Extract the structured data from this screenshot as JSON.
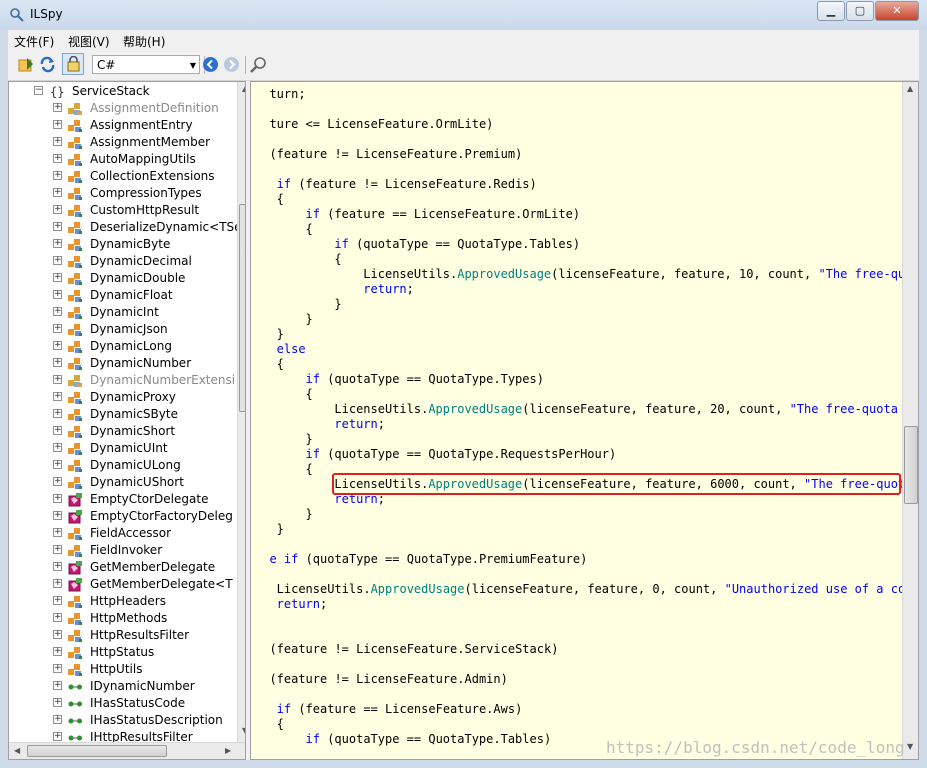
{
  "window": {
    "title": "ILSpy",
    "minimize": "▁",
    "maximize": "▢",
    "close": "✕"
  },
  "menu": [
    "文件(F)",
    "视图(V)",
    "帮助(H)"
  ],
  "toolbar": {
    "language": "C#",
    "icons": [
      "open-icon",
      "reload-icon",
      "show-internal-icon",
      "back-icon",
      "forward-icon",
      "search-icon"
    ]
  },
  "tree": {
    "namespace": {
      "label": "ServiceStack",
      "icon": "namespace-icon"
    },
    "items": [
      {
        "label": "AssignmentDefinition",
        "icon": "internal-class-icon",
        "gray": true
      },
      {
        "label": "AssignmentEntry",
        "icon": "class-icon",
        "gray": false
      },
      {
        "label": "AssignmentMember",
        "icon": "class-icon",
        "gray": false
      },
      {
        "label": "AutoMappingUtils",
        "icon": "class-icon",
        "gray": false
      },
      {
        "label": "CollectionExtensions",
        "icon": "class-icon",
        "gray": false
      },
      {
        "label": "CompressionTypes",
        "icon": "class-icon",
        "gray": false
      },
      {
        "label": "CustomHttpResult",
        "icon": "class-icon",
        "gray": false
      },
      {
        "label": "DeserializeDynamic<TSe",
        "icon": "class-icon",
        "gray": false
      },
      {
        "label": "DynamicByte",
        "icon": "class-icon",
        "gray": false
      },
      {
        "label": "DynamicDecimal",
        "icon": "class-icon",
        "gray": false
      },
      {
        "label": "DynamicDouble",
        "icon": "class-icon",
        "gray": false
      },
      {
        "label": "DynamicFloat",
        "icon": "class-icon",
        "gray": false
      },
      {
        "label": "DynamicInt",
        "icon": "class-icon",
        "gray": false
      },
      {
        "label": "DynamicJson",
        "icon": "class-icon",
        "gray": false
      },
      {
        "label": "DynamicLong",
        "icon": "class-icon",
        "gray": false
      },
      {
        "label": "DynamicNumber",
        "icon": "class-icon",
        "gray": false
      },
      {
        "label": "DynamicNumberExtensi",
        "icon": "internal-class-icon",
        "gray": true
      },
      {
        "label": "DynamicProxy",
        "icon": "class-icon",
        "gray": false
      },
      {
        "label": "DynamicSByte",
        "icon": "class-icon",
        "gray": false
      },
      {
        "label": "DynamicShort",
        "icon": "class-icon",
        "gray": false
      },
      {
        "label": "DynamicUInt",
        "icon": "class-icon",
        "gray": false
      },
      {
        "label": "DynamicULong",
        "icon": "class-icon",
        "gray": false
      },
      {
        "label": "DynamicUShort",
        "icon": "class-icon",
        "gray": false
      },
      {
        "label": "EmptyCtorDelegate",
        "icon": "delegate-icon",
        "gray": false
      },
      {
        "label": "EmptyCtorFactoryDeleg",
        "icon": "delegate-icon",
        "gray": false
      },
      {
        "label": "FieldAccessor",
        "icon": "class-icon",
        "gray": false
      },
      {
        "label": "FieldInvoker",
        "icon": "class-icon",
        "gray": false
      },
      {
        "label": "GetMemberDelegate",
        "icon": "delegate-icon",
        "gray": false
      },
      {
        "label": "GetMemberDelegate<T",
        "icon": "delegate-icon",
        "gray": false
      },
      {
        "label": "HttpHeaders",
        "icon": "class-icon",
        "gray": false
      },
      {
        "label": "HttpMethods",
        "icon": "class-icon",
        "gray": false
      },
      {
        "label": "HttpResultsFilter",
        "icon": "class-icon",
        "gray": false
      },
      {
        "label": "HttpStatus",
        "icon": "class-icon",
        "gray": false
      },
      {
        "label": "HttpUtils",
        "icon": "class-icon",
        "gray": false
      },
      {
        "label": "IDynamicNumber",
        "icon": "interface-icon",
        "gray": false
      },
      {
        "label": "IHasStatusCode",
        "icon": "interface-icon",
        "gray": false
      },
      {
        "label": "IHasStatusDescription",
        "icon": "interface-icon",
        "gray": false
      },
      {
        "label": "IHttpResultsFilter",
        "icon": "interface-icon",
        "gray": false
      }
    ]
  },
  "code": [
    {
      "indent": 2,
      "parts": [
        [
          "t",
          "turn;"
        ]
      ]
    },
    {
      "indent": 0,
      "parts": []
    },
    {
      "indent": 2,
      "parts": [
        [
          "t",
          "ture <= LicenseFeature.OrmLite)"
        ]
      ]
    },
    {
      "indent": 0,
      "parts": []
    },
    {
      "indent": 2,
      "parts": [
        [
          "t",
          "(feature != LicenseFeature.Premium)"
        ]
      ]
    },
    {
      "indent": 0,
      "parts": []
    },
    {
      "indent": 3,
      "parts": [
        [
          "k",
          "if"
        ],
        [
          "t",
          " (feature != LicenseFeature.Redis)"
        ]
      ]
    },
    {
      "indent": 3,
      "parts": [
        [
          "t",
          "{"
        ]
      ]
    },
    {
      "indent": 7,
      "parts": [
        [
          "k",
          "if"
        ],
        [
          "t",
          " (feature == LicenseFeature.OrmLite)"
        ]
      ]
    },
    {
      "indent": 7,
      "parts": [
        [
          "t",
          "{"
        ]
      ]
    },
    {
      "indent": 11,
      "parts": [
        [
          "k",
          "if"
        ],
        [
          "t",
          " (quotaType == QuotaType.Tables)"
        ]
      ]
    },
    {
      "indent": 11,
      "parts": [
        [
          "t",
          "{"
        ]
      ]
    },
    {
      "indent": 15,
      "parts": [
        [
          "t",
          "LicenseUtils."
        ],
        [
          "m",
          "ApprovedUsage"
        ],
        [
          "t",
          "(licenseFeature, feature, 10, count, "
        ],
        [
          "s",
          "\"The free-quota"
        ]
      ]
    },
    {
      "indent": 15,
      "parts": [
        [
          "k",
          "return"
        ],
        [
          "t",
          ";"
        ]
      ]
    },
    {
      "indent": 11,
      "parts": [
        [
          "t",
          "}"
        ]
      ]
    },
    {
      "indent": 7,
      "parts": [
        [
          "t",
          "}"
        ]
      ]
    },
    {
      "indent": 3,
      "parts": [
        [
          "t",
          "}"
        ]
      ]
    },
    {
      "indent": 3,
      "parts": [
        [
          "k",
          "else"
        ]
      ]
    },
    {
      "indent": 3,
      "parts": [
        [
          "t",
          "{"
        ]
      ]
    },
    {
      "indent": 7,
      "parts": [
        [
          "k",
          "if"
        ],
        [
          "t",
          " (quotaType == QuotaType.Types)"
        ]
      ]
    },
    {
      "indent": 7,
      "parts": [
        [
          "t",
          "{"
        ]
      ]
    },
    {
      "indent": 11,
      "parts": [
        [
          "t",
          "LicenseUtils."
        ],
        [
          "m",
          "ApprovedUsage"
        ],
        [
          "t",
          "(licenseFeature, feature, 20, count, "
        ],
        [
          "s",
          "\"The free-quota lin"
        ]
      ]
    },
    {
      "indent": 11,
      "parts": [
        [
          "k",
          "return"
        ],
        [
          "t",
          ";"
        ]
      ]
    },
    {
      "indent": 7,
      "parts": [
        [
          "t",
          "}"
        ]
      ]
    },
    {
      "indent": 7,
      "parts": [
        [
          "k",
          "if"
        ],
        [
          "t",
          " (quotaType == QuotaType.RequestsPerHour)"
        ]
      ]
    },
    {
      "indent": 7,
      "parts": [
        [
          "t",
          "{"
        ]
      ]
    },
    {
      "indent": 11,
      "parts": [
        [
          "t",
          "LicenseUtils."
        ],
        [
          "m",
          "ApprovedUsage"
        ],
        [
          "t",
          "(licenseFeature, feature, 6000, count, "
        ],
        [
          "s",
          "\"The free-quota l"
        ]
      ]
    },
    {
      "indent": 11,
      "parts": [
        [
          "k",
          "return"
        ],
        [
          "t",
          ";"
        ]
      ]
    },
    {
      "indent": 7,
      "parts": [
        [
          "t",
          "}"
        ]
      ]
    },
    {
      "indent": 3,
      "parts": [
        [
          "t",
          "}"
        ]
      ]
    },
    {
      "indent": 0,
      "parts": []
    },
    {
      "indent": 2,
      "parts": [
        [
          "k",
          "e if"
        ],
        [
          "t",
          " (quotaType == QuotaType.PremiumFeature)"
        ]
      ]
    },
    {
      "indent": 0,
      "parts": []
    },
    {
      "indent": 3,
      "parts": [
        [
          "t",
          "LicenseUtils."
        ],
        [
          "m",
          "ApprovedUsage"
        ],
        [
          "t",
          "(licenseFeature, feature, 0, count, "
        ],
        [
          "s",
          "\"Unauthorized use of a comme"
        ]
      ]
    },
    {
      "indent": 3,
      "parts": [
        [
          "k",
          "return"
        ],
        [
          "t",
          ";"
        ]
      ]
    },
    {
      "indent": 0,
      "parts": []
    },
    {
      "indent": 0,
      "parts": []
    },
    {
      "indent": 2,
      "parts": [
        [
          "t",
          "(feature != LicenseFeature.ServiceStack)"
        ]
      ]
    },
    {
      "indent": 0,
      "parts": []
    },
    {
      "indent": 2,
      "parts": [
        [
          "t",
          "(feature != LicenseFeature.Admin)"
        ]
      ]
    },
    {
      "indent": 0,
      "parts": []
    },
    {
      "indent": 3,
      "parts": [
        [
          "k",
          "if"
        ],
        [
          "t",
          " (feature == LicenseFeature.Aws)"
        ]
      ]
    },
    {
      "indent": 3,
      "parts": [
        [
          "t",
          "{"
        ]
      ]
    },
    {
      "indent": 7,
      "parts": [
        [
          "k",
          "if"
        ],
        [
          "t",
          " (quotaType == QuotaType.Tables)"
        ]
      ]
    }
  ],
  "watermark": "https://blog.csdn.net/code_long"
}
